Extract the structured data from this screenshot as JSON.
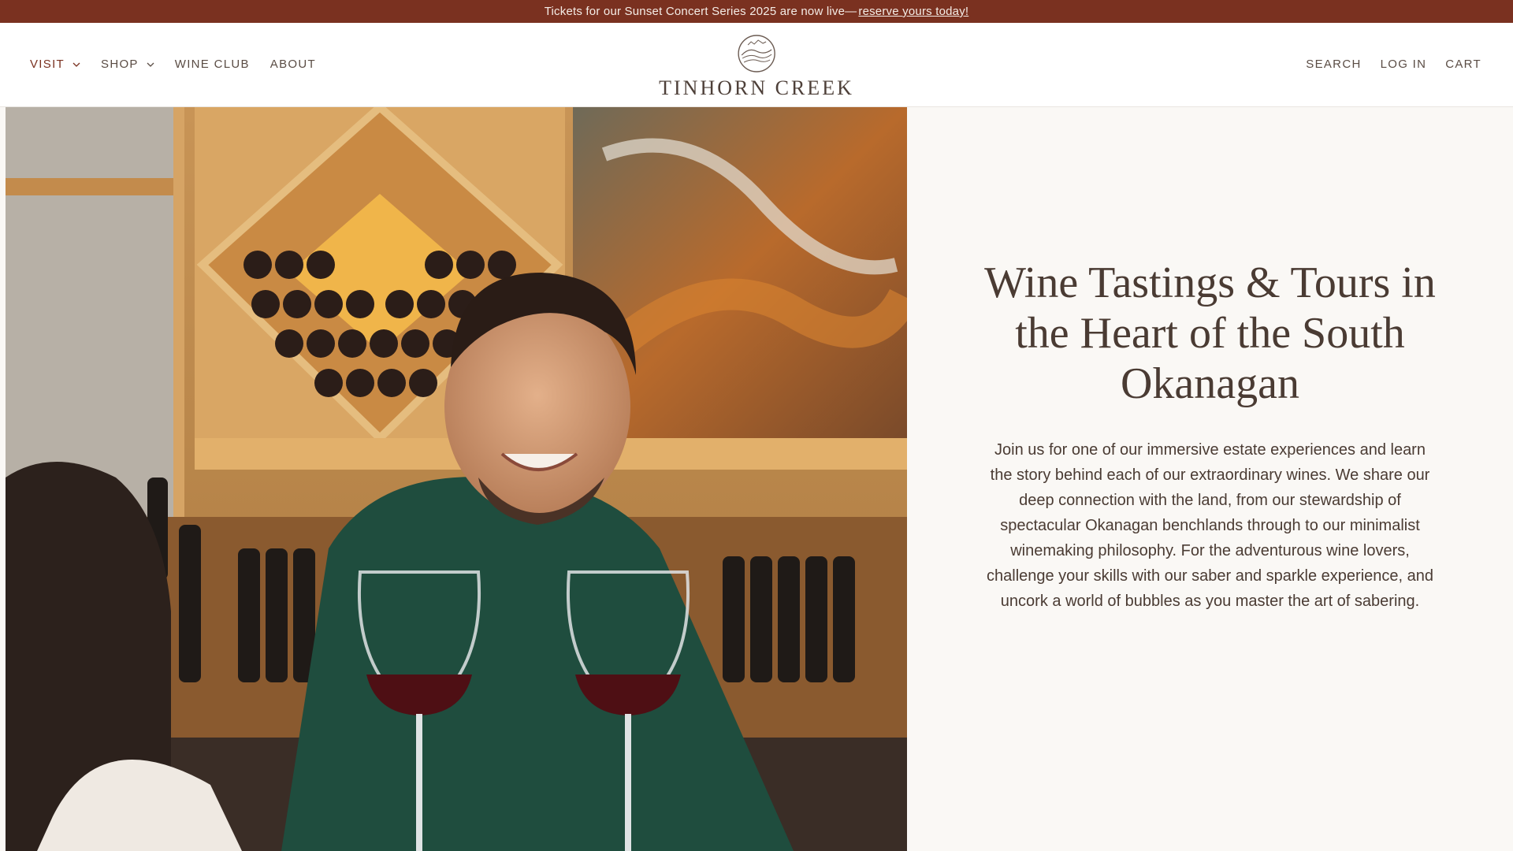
{
  "announcement": {
    "text": "Tickets for our Sunset Concert Series 2025 are now live—",
    "link": "reserve yours today!"
  },
  "nav": {
    "left": [
      {
        "label": "VISIT",
        "dropdown": true,
        "active": true
      },
      {
        "label": "SHOP",
        "dropdown": true,
        "active": false
      },
      {
        "label": "WINE CLUB",
        "dropdown": false,
        "active": false
      },
      {
        "label": "ABOUT",
        "dropdown": false,
        "active": false
      }
    ],
    "right": [
      {
        "label": "SEARCH"
      },
      {
        "label": "LOG IN"
      },
      {
        "label": "CART"
      }
    ]
  },
  "brand": {
    "name": "TINHORN CREEK",
    "logo_icon": "vineyard-emblem-icon"
  },
  "hero": {
    "image_alt": "winery-staff-photo",
    "title": "Wine Tastings & Tours in the Heart of the South Okanagan",
    "body": "Join us for one of our immersive estate experiences and learn the story behind each of our extraordinary wines. We share our deep connection with the land, from our stewardship of spectacular Okanagan benchlands through to our minimalist winemaking philosophy. For the adventurous wine lovers, challenge your skills with our saber and sparkle experience, and uncork a world of bubbles as you master the art of sabering."
  },
  "colors": {
    "announcement_bg": "#7a3120",
    "accent": "#7a3120",
    "text": "#4a3b33",
    "hero_bg": "#faf8f5"
  }
}
